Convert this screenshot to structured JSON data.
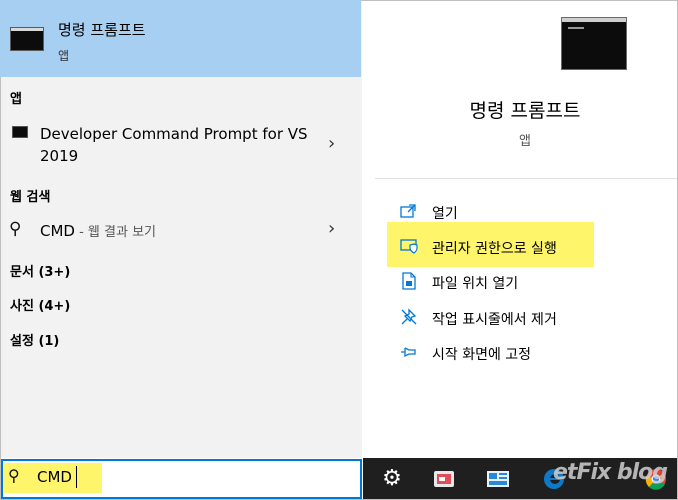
{
  "best_match": {
    "title": "명령 프롬프트",
    "subtitle": "앱",
    "icon": "command-prompt-icon"
  },
  "sections": {
    "apps": "앱",
    "web": "웹 검색",
    "documents": "문서 (3+)",
    "photos": "사진 (4+)",
    "settings": "설정 (1)"
  },
  "apps_items": [
    {
      "label": "Developer Command Prompt for VS 2019",
      "icon": "command-prompt-icon"
    }
  ],
  "web_result": {
    "query": "CMD",
    "suffix": " - 웹 결과 보기"
  },
  "detail": {
    "title": "명령 프롬프트",
    "subtitle": "앱",
    "actions": [
      {
        "label": "열기",
        "icon": "open-icon"
      },
      {
        "label": "관리자 권한으로 실행",
        "icon": "run-as-admin-icon"
      },
      {
        "label": "파일 위치 열기",
        "icon": "file-location-icon"
      },
      {
        "label": "작업 표시줄에서 제거",
        "icon": "unpin-taskbar-icon"
      },
      {
        "label": "시작 화면에 고정",
        "icon": "pin-start-icon"
      }
    ]
  },
  "search": {
    "value": "CMD"
  },
  "taskbar": {
    "items": [
      "settings-icon",
      "app-icon",
      "app-icon",
      "edge-icon",
      "chrome-icon"
    ],
    "watermark": "etFix blog"
  },
  "colors": {
    "selected": "#a6cff2",
    "highlight": "#fff56b",
    "accent": "#0078d7",
    "panel": "#f2f2f2",
    "taskbar": "#1f1f1f"
  }
}
